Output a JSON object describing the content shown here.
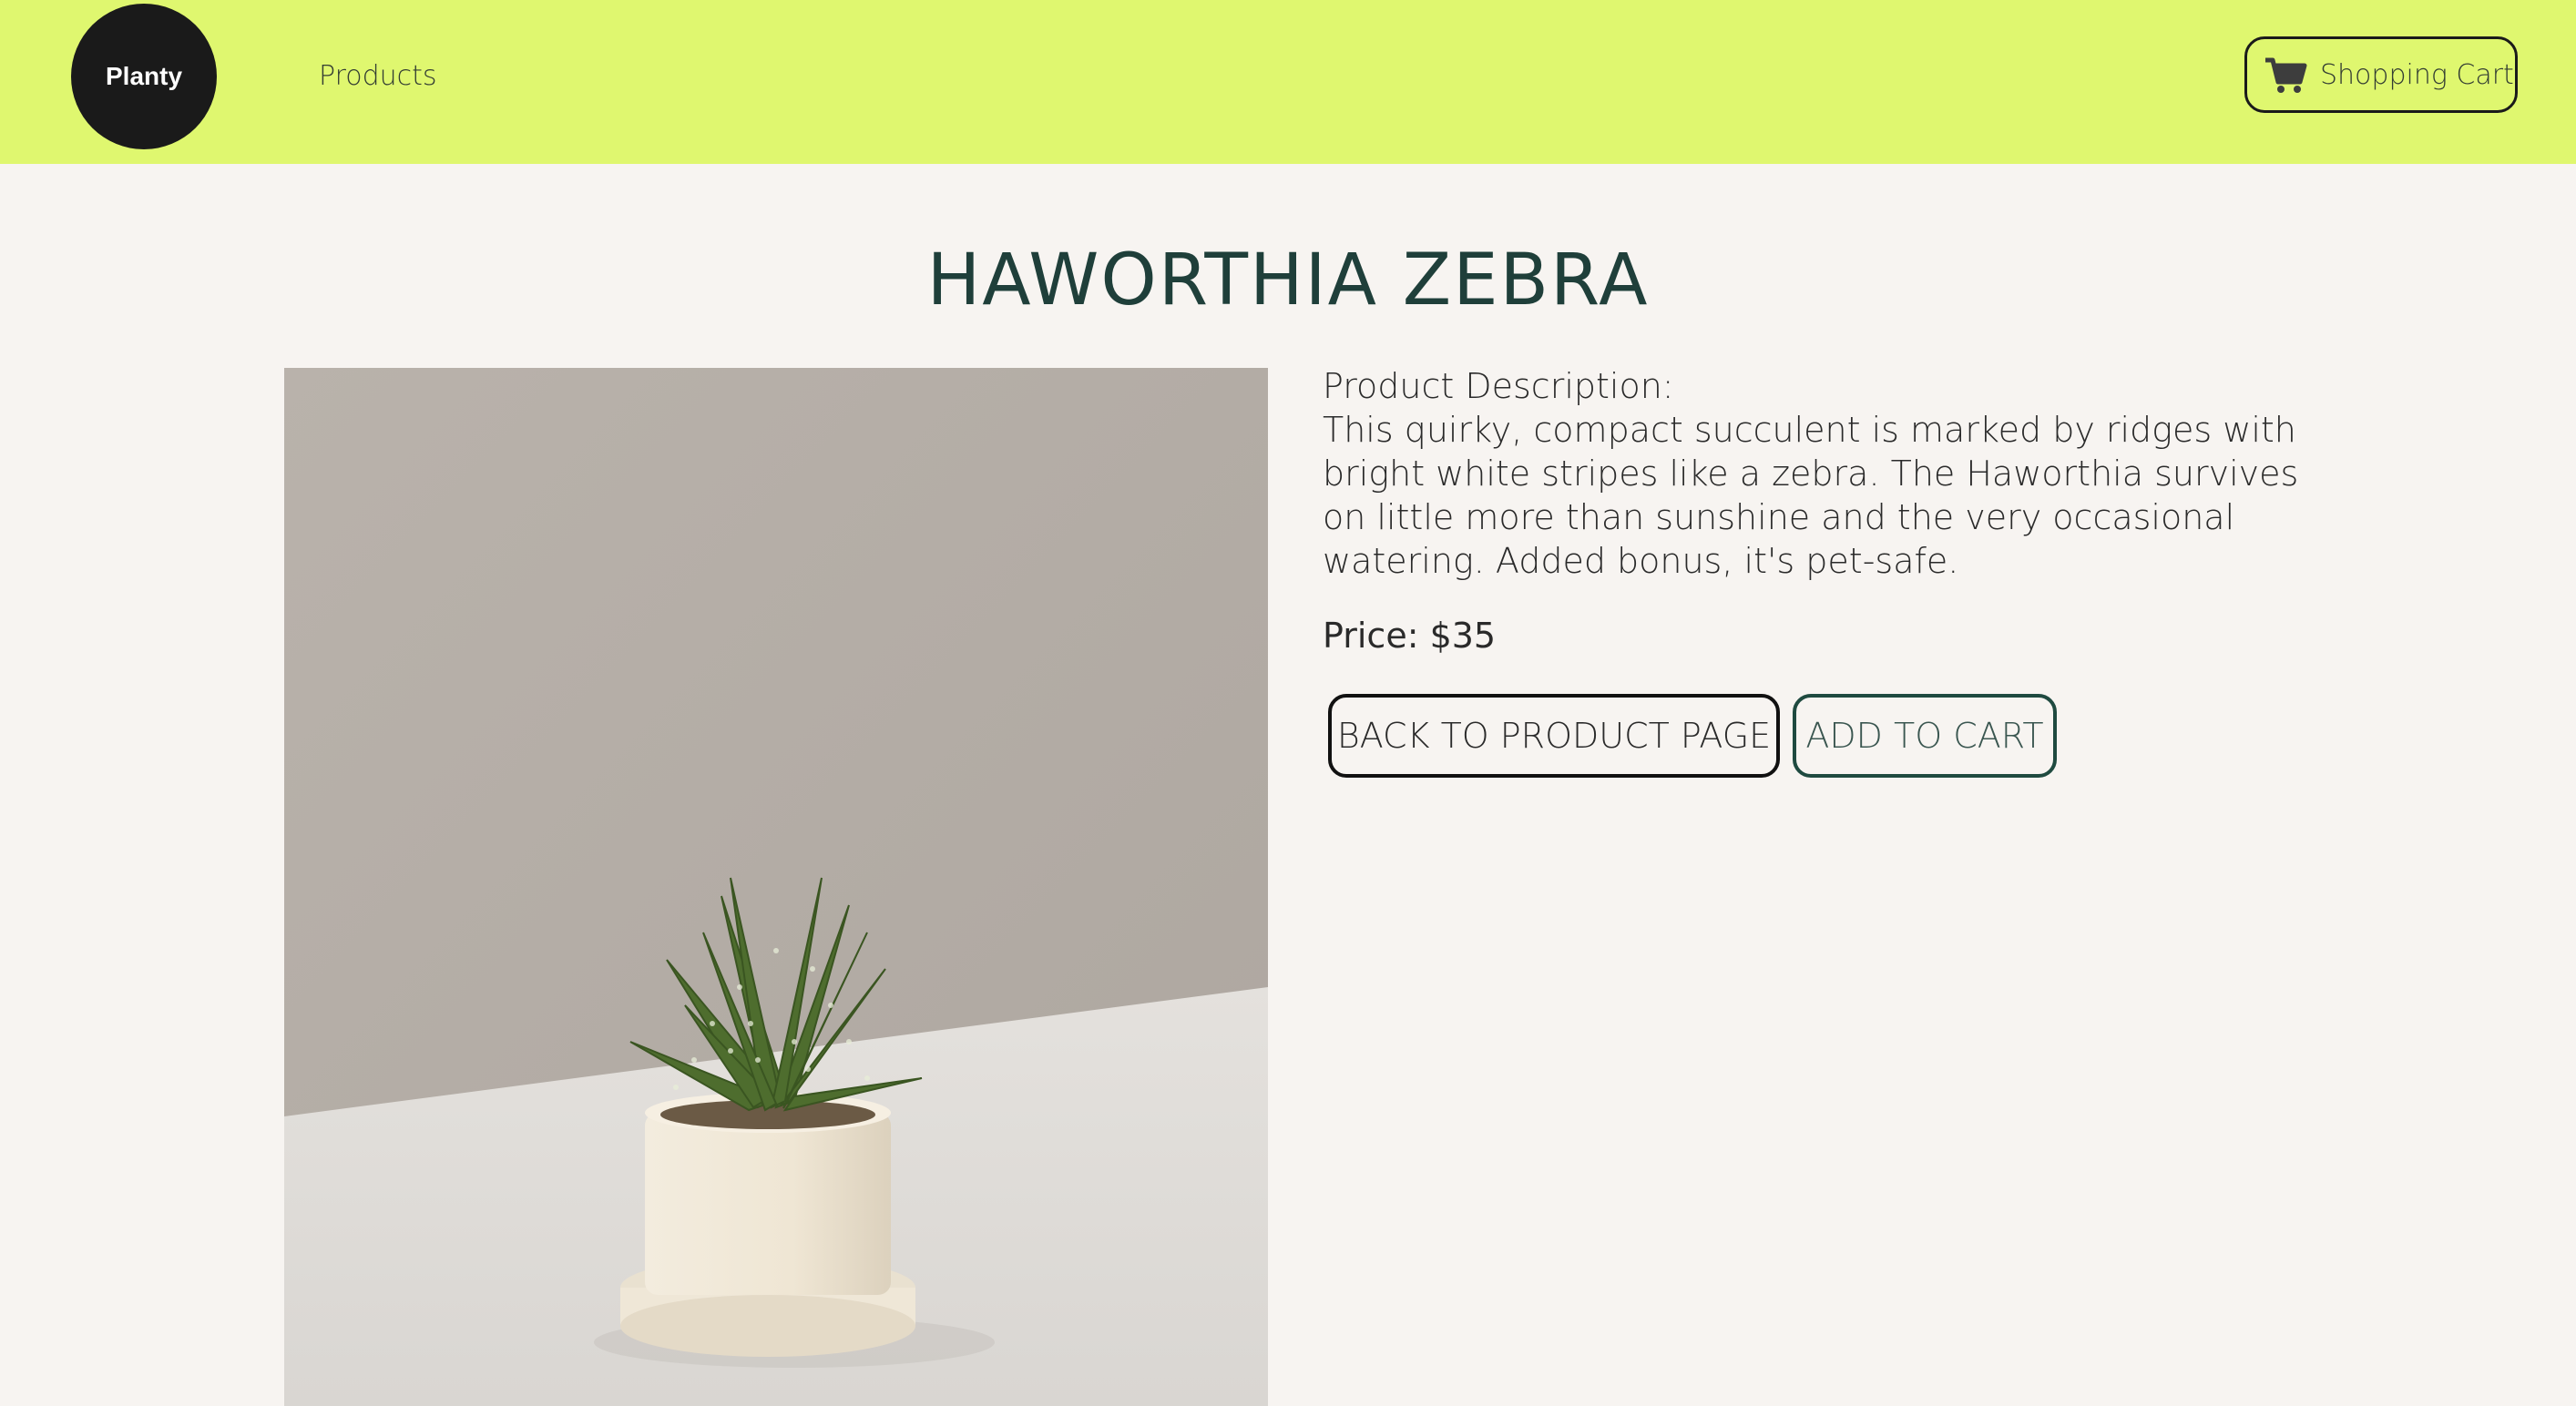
{
  "header": {
    "logo_text": "Planty",
    "nav_products": "Products",
    "cart_label": "Shopping Cart",
    "cart_icon": "shopping-cart-icon",
    "background_color": "#dff76f"
  },
  "product": {
    "title": "HAWORTHIA ZEBRA",
    "description_label": "Product Description:",
    "description": "This quirky, compact succulent is marked by ridges with bright white stripes like a zebra. The Haworthia survives on little more than sunshine and the very occasional watering. Added bonus, it's pet-safe.",
    "price_text": "Price: $35",
    "back_button": "BACK TO PRODUCT PAGE",
    "add_button": "ADD TO CART"
  },
  "colors": {
    "accent": "#dff76f",
    "title": "#1f3f3a",
    "background": "#f7f4f1"
  }
}
